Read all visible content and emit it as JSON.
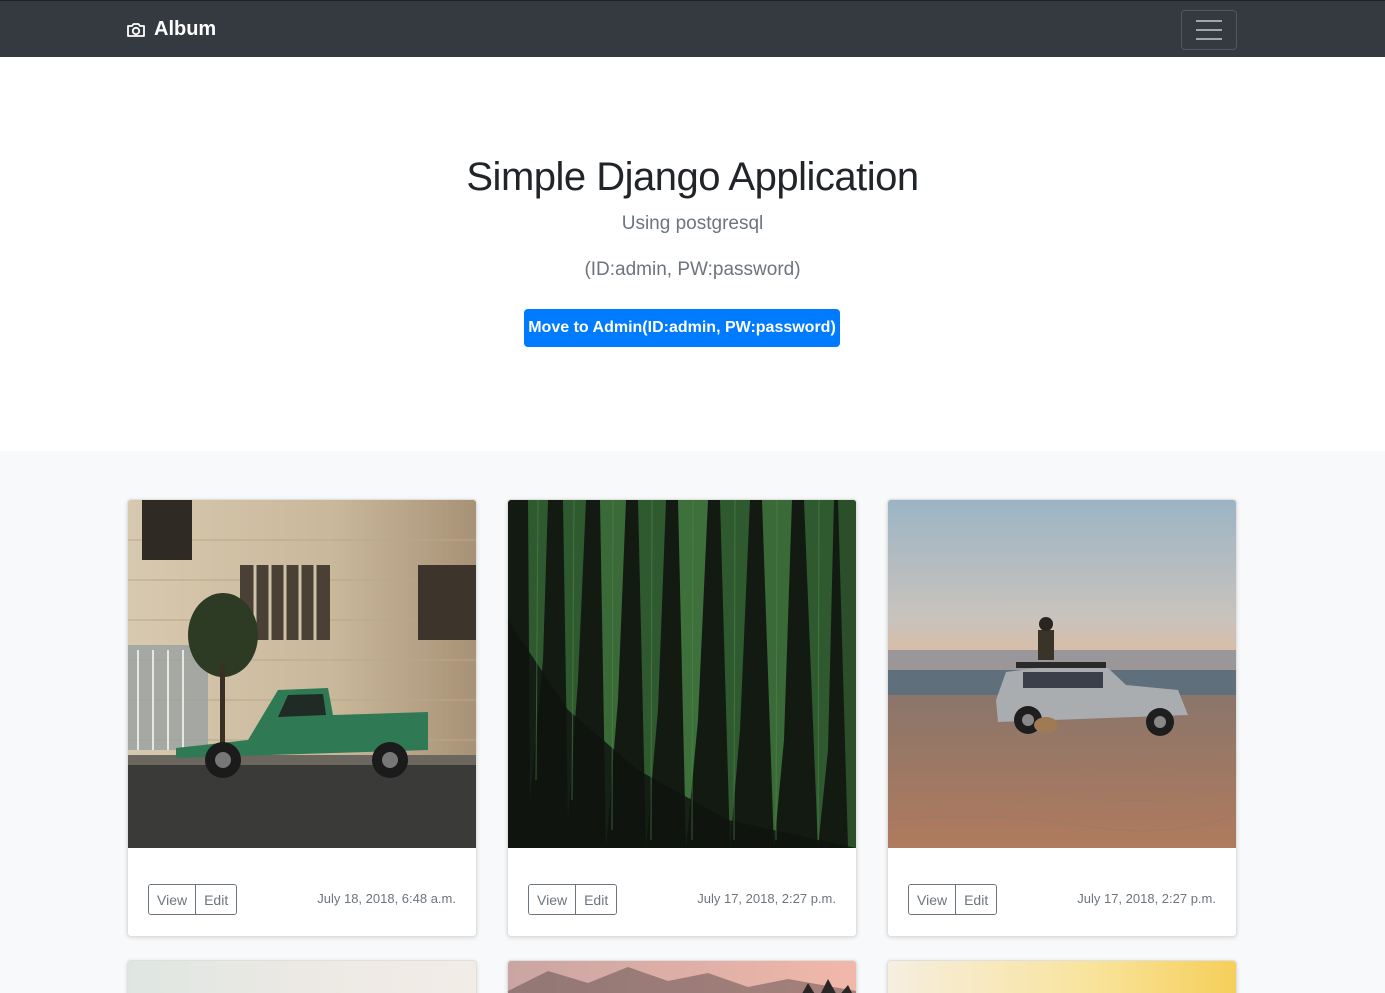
{
  "navbar": {
    "brand": "Album",
    "brand_icon": "camera-icon",
    "toggle_icon": "hamburger-menu-icon"
  },
  "hero": {
    "title": "Simple Django Application",
    "subtitle": "Using postgresql",
    "credentials": "(ID:admin, PW:password)",
    "admin_button": "Move to Admin(ID:admin, PW:password)"
  },
  "cards": [
    {
      "view_label": "View",
      "edit_label": "Edit",
      "date": "July 18, 2018, 6:48 a.m."
    },
    {
      "view_label": "View",
      "edit_label": "Edit",
      "date": "July 17, 2018, 2:27 p.m."
    },
    {
      "view_label": "View",
      "edit_label": "Edit",
      "date": "July 17, 2018, 2:27 p.m."
    }
  ],
  "colors": {
    "navbar": "#343a40",
    "primary": "#007bff",
    "muted": "#6c757d",
    "album_bg": "#f8f9fa"
  }
}
